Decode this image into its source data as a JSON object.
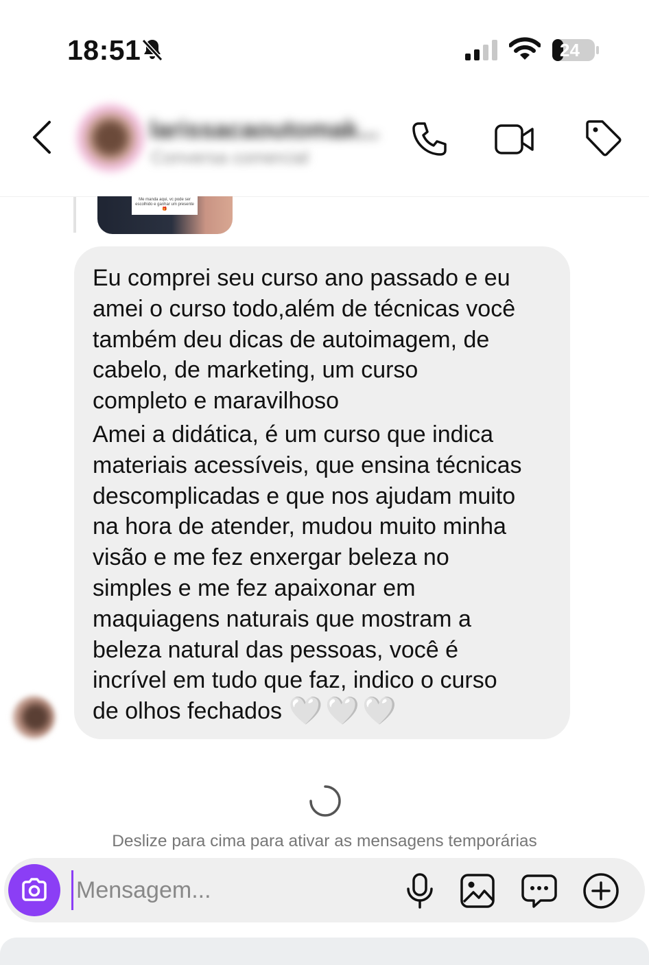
{
  "status_bar": {
    "time": "18:51",
    "battery_level": "24"
  },
  "header": {
    "contact_name": "larissacaoutomak...",
    "contact_subtitle": "Conversa comercial"
  },
  "thread": {
    "story_caption": "Me manda aqui, vc pode ser escolhido e ganhar um presente 🎁",
    "message_paragraph_1": "Eu comprei seu curso ano passado e eu\namei o curso todo,além de técnicas você\ntambém deu dicas de autoimagem, de\ncabelo, de marketing, um curso\ncompleto e maravilhoso",
    "message_paragraph_2": "Amei a didática, é um curso que indica\nmateriais acessíveis, que ensina técnicas\ndescomplicadas e que nos ajudam muito\nna hora de atender, mudou muito minha\nvisão e me fez enxergar beleza no\nsimples e me fez apaixonar em\nmaquiagens naturais que mostram a\nbeleza natural das pessoas, você é\nincrível em tudo que faz, indico o curso\nde olhos fechados",
    "message_emoji": "🤍🤍🤍"
  },
  "hint_text": "Deslize para cima para ativar as mensagens temporárias",
  "composer": {
    "placeholder": "Mensagem..."
  },
  "colors": {
    "accent": "#8b3ef5",
    "bubble_bg": "#efefef",
    "hint": "#777777"
  }
}
